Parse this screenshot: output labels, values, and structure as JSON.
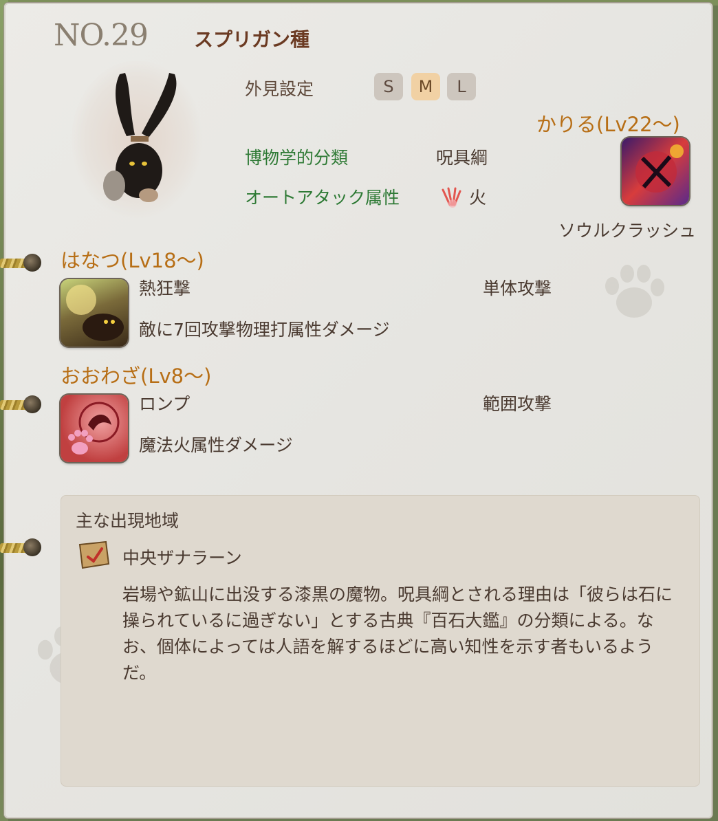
{
  "header": {
    "number": "NO.29",
    "title": "スプリガン種"
  },
  "appearance": {
    "label": "外見設定",
    "sizes": [
      {
        "label": "S",
        "active": false
      },
      {
        "label": "M",
        "active": true
      },
      {
        "label": "L",
        "active": false
      }
    ]
  },
  "classification": {
    "label": "博物学的分類",
    "value": "呪具綱"
  },
  "auto_attack": {
    "label": "オートアタック属性",
    "element": "火",
    "icon": "fire-claw-icon"
  },
  "karu": {
    "heading": "かりる(Lv22～)",
    "skill_name": "ソウルクラッシュ",
    "icon": "soul-crush-icon"
  },
  "hanatsu": {
    "heading": "はなつ(Lv18～)",
    "skill_name": "熱狂撃",
    "type": "単体攻撃",
    "description": "敵に7回攻撃物理打属性ダメージ",
    "icon": "frenzy-strike-icon"
  },
  "oowaza": {
    "heading": "おおわざ(Lv8～)",
    "skill_name": "ロンプ",
    "type": "範囲攻撃",
    "description": "魔法火属性ダメージ",
    "icon": "romp-icon"
  },
  "region": {
    "label": "主な出現地域",
    "area": "中央ザナラーン",
    "icon": "map-scroll-icon",
    "description": "岩場や鉱山に出没する漆黒の魔物。呪具綱とされる理由は「彼らは石に操られているに過ぎない」とする古典『百石大鑑』の分類による。なお、個体によっては人語を解するほどに高い知性を示す者もいるようだ。"
  },
  "colors": {
    "heading": "#b76e15",
    "green": "#2e7a35",
    "text": "#4a3a30"
  }
}
